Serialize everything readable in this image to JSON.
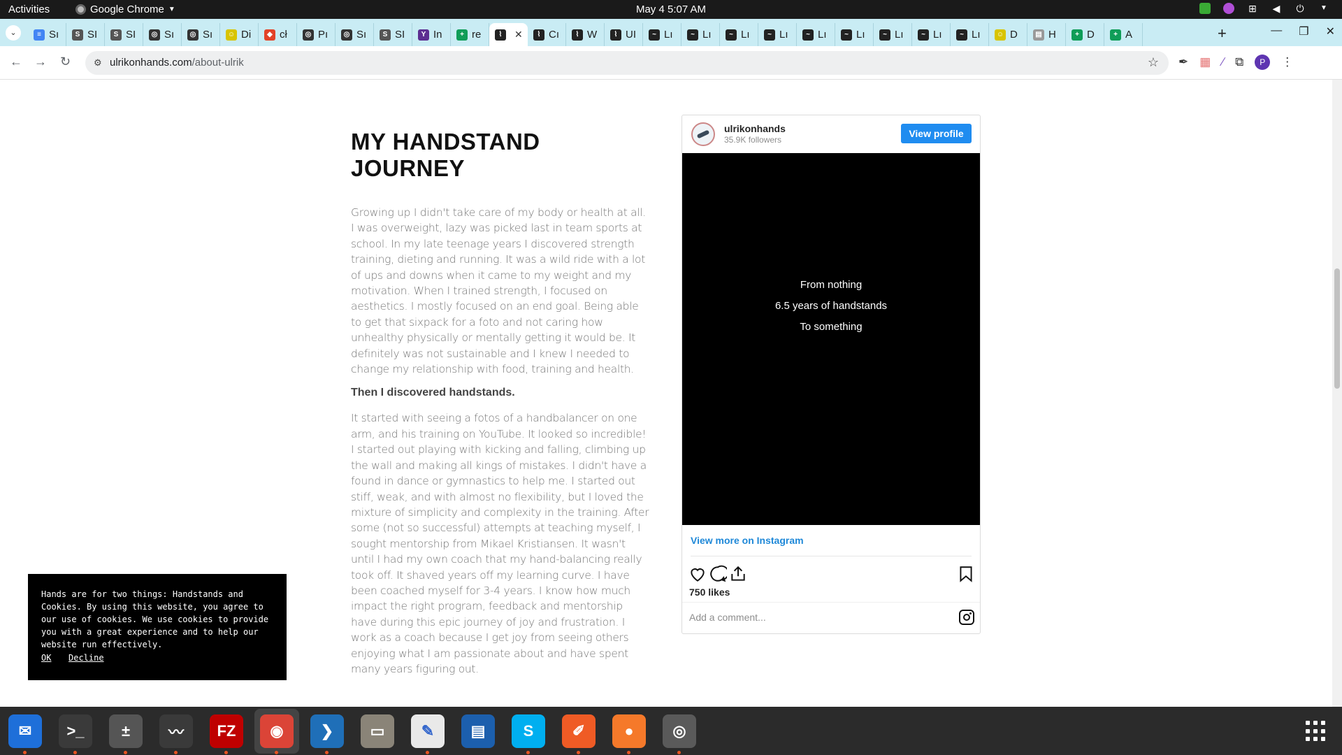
{
  "system": {
    "activities": "Activities",
    "app_name": "Google Chrome",
    "clock": "May 4  5:07 AM"
  },
  "tabs": [
    {
      "icon": "docs-icon",
      "label": "Sı",
      "color": "#4285f4",
      "glyph": "≡"
    },
    {
      "icon": "snp-icon",
      "label": "SI",
      "color": "#555",
      "glyph": "S"
    },
    {
      "icon": "snp-icon",
      "label": "SI",
      "color": "#555",
      "glyph": "S"
    },
    {
      "icon": "chatgpt-icon",
      "label": "Sı",
      "color": "#333",
      "glyph": "◎"
    },
    {
      "icon": "chatgpt-icon",
      "label": "Sı",
      "color": "#333",
      "glyph": "◎"
    },
    {
      "icon": "smile-icon",
      "label": "Di",
      "color": "#d8c400",
      "glyph": "☺"
    },
    {
      "icon": "gitlab-icon",
      "label": "cł",
      "color": "#e24329",
      "glyph": "◆"
    },
    {
      "icon": "chatgpt-icon",
      "label": "Pı",
      "color": "#333",
      "glyph": "◎"
    },
    {
      "icon": "chatgpt-icon",
      "label": "Sı",
      "color": "#333",
      "glyph": "◎"
    },
    {
      "icon": "snp-icon",
      "label": "SI",
      "color": "#555",
      "glyph": "S"
    },
    {
      "icon": "yahoo-icon",
      "label": "In",
      "color": "#5c2d91",
      "glyph": "Y"
    },
    {
      "icon": "sheets-icon",
      "label": "re",
      "color": "#0f9d58",
      "glyph": "+"
    },
    {
      "icon": "handstand-icon",
      "label": "",
      "color": "#222",
      "glyph": "⌇",
      "active": true
    },
    {
      "icon": "handstand-icon",
      "label": "Cı",
      "color": "#222",
      "glyph": "⌇"
    },
    {
      "icon": "handstand-icon",
      "label": "W",
      "color": "#222",
      "glyph": "⌇"
    },
    {
      "icon": "handstand-icon",
      "label": "UI",
      "color": "#222",
      "glyph": "⌇"
    },
    {
      "icon": "loom-icon",
      "label": "Lı",
      "color": "#222",
      "glyph": "~"
    },
    {
      "icon": "loom-icon",
      "label": "Lı",
      "color": "#222",
      "glyph": "~"
    },
    {
      "icon": "loom-icon",
      "label": "Lı",
      "color": "#222",
      "glyph": "~"
    },
    {
      "icon": "loom-icon",
      "label": "Lı",
      "color": "#222",
      "glyph": "~"
    },
    {
      "icon": "loom-icon",
      "label": "Lı",
      "color": "#222",
      "glyph": "~"
    },
    {
      "icon": "loom-icon",
      "label": "Lı",
      "color": "#222",
      "glyph": "~"
    },
    {
      "icon": "loom-icon",
      "label": "Lı",
      "color": "#222",
      "glyph": "~"
    },
    {
      "icon": "loom-icon",
      "label": "Lı",
      "color": "#222",
      "glyph": "~"
    },
    {
      "icon": "loom-icon",
      "label": "Lı",
      "color": "#222",
      "glyph": "~"
    },
    {
      "icon": "smile-icon",
      "label": "D",
      "color": "#d8c400",
      "glyph": "☺"
    },
    {
      "icon": "page-icon",
      "label": "H",
      "color": "#999",
      "glyph": "▤"
    },
    {
      "icon": "sheets-icon",
      "label": "D",
      "color": "#0f9d58",
      "glyph": "+"
    },
    {
      "icon": "sheets-icon",
      "label": "A",
      "color": "#0f9d58",
      "glyph": "+"
    }
  ],
  "address": {
    "domain": "ulrikonhands.com",
    "path": "/about-ulrik"
  },
  "article": {
    "title": "MY HANDSTAND JOURNEY",
    "para1": "Growing up I didn't take care of my body or health at all. I was overweight, lazy was picked last in team sports at school. In my late teenage years I discovered strength training, dieting and running. It was a wild ride with a lot of ups and downs when it came to my weight and my motivation. When I trained strength, I focused on aesthetics. I mostly focused on an end goal. Being able to get that sixpack for a foto and not caring how unhealthy physically or mentally getting it would be. It definitely was not sustainable and I knew I needed to change my relationship with food, training and health.",
    "subheading": "Then I discovered handstands.",
    "para2": "It started with seeing a fotos of a handbalancer on one arm, and his training on YouTube. It looked so incredible! I started out playing with kicking and falling, climbing up the wall and making all kings of mistakes. I didn't have a found in dance or gymnastics to help me. I started out stiff, weak, and with almost no flexibility, but I loved the mixture of simplicity and complexity in the training. After some (not so successful) attempts at teaching myself, I sought mentorship from Mikael Kristiansen. It wasn't until I had my own coach that my hand-balancing really took off. It shaved years off my learning curve. I have been coached myself for 3-4 years. I know how much impact the right program, feedback and mentorship have during this epic journey of joy and frustration. I work as a coach because I get joy from seeing others enjoying what I am passionate about and have spent many years figuring out."
  },
  "instagram": {
    "username": "ulrikonhands",
    "followers": "35.9K followers",
    "view_profile": "View profile",
    "media_lines": [
      "From nothing",
      "6.5 years of handstands",
      "To something"
    ],
    "view_more": "View more on Instagram",
    "likes": "750 likes",
    "comment_placeholder": "Add a comment..."
  },
  "cookie": {
    "text": "Hands are for two things: Handstands and Cookies. By using this website, you agree to our use of cookies. We use cookies to provide you with a great experience and to help our website run effectively.",
    "ok": "OK",
    "decline": "Decline"
  },
  "dock": [
    {
      "name": "thunderbird-icon",
      "color": "#1e6fd9",
      "glyph": "✉",
      "running": true
    },
    {
      "name": "terminal-icon",
      "color": "#3a3a3a",
      "glyph": ">_",
      "running": true
    },
    {
      "name": "calculator-icon",
      "color": "#555555",
      "glyph": "±",
      "running": true
    },
    {
      "name": "system-monitor-icon",
      "color": "#3a3a3a",
      "glyph": "〰",
      "running": true
    },
    {
      "name": "filezilla-icon",
      "color": "#bf0000",
      "glyph": "FZ",
      "running": true
    },
    {
      "name": "chrome-icon",
      "color": "#db4437",
      "glyph": "◉",
      "running": true
    },
    {
      "name": "vscode-icon",
      "color": "#1f6fb8",
      "glyph": "❯",
      "running": true
    },
    {
      "name": "files-icon",
      "color": "#8a8478",
      "glyph": "▭",
      "running": false
    },
    {
      "name": "text-editor-icon",
      "color": "#e9e9e9",
      "glyph": "✎",
      "running": true
    },
    {
      "name": "writer-icon",
      "color": "#1c5fad",
      "glyph": "▤",
      "running": false
    },
    {
      "name": "skype-icon",
      "color": "#00aff0",
      "glyph": "S",
      "running": true
    },
    {
      "name": "postman-icon",
      "color": "#ef5b25",
      "glyph": "✐",
      "running": true
    },
    {
      "name": "blender-icon",
      "color": "#f5792a",
      "glyph": "●",
      "running": true
    },
    {
      "name": "disk-icon",
      "color": "#5a5a5a",
      "glyph": "◎",
      "running": true
    }
  ]
}
